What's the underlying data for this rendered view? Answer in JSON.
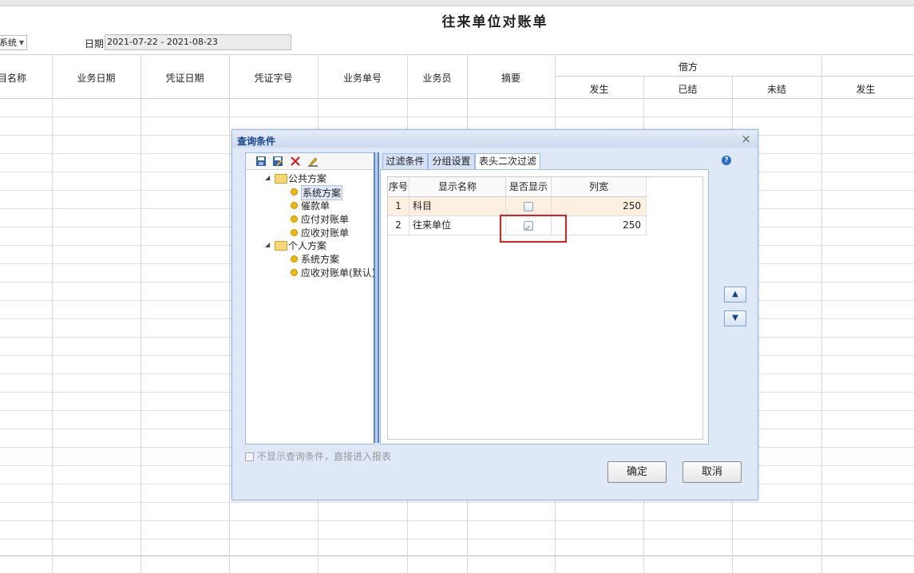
{
  "report": {
    "title": "往来单位对账单",
    "combo_value": "系统",
    "date_label": "日期",
    "date_value": "2021-07-22 - 2021-08-23"
  },
  "grid": {
    "headers": [
      "目名称",
      "业务日期",
      "凭证日期",
      "凭证字号",
      "业务单号",
      "业务员",
      "摘要"
    ],
    "group_debit": "借方",
    "sub_headers": [
      "发生",
      "已结",
      "未结",
      "发生"
    ]
  },
  "dialog": {
    "title": "查询条件",
    "close": "×",
    "tree": {
      "public": "公共方案",
      "public_items": [
        "系统方案",
        "催款单",
        "应付对账单",
        "应收对账单"
      ],
      "personal": "个人方案",
      "personal_items": [
        "系统方案",
        "应收对账单(默认)"
      ]
    },
    "tabs": [
      "过滤条件",
      "分组设置",
      "表头二次过滤"
    ],
    "active_tab": 2,
    "table": {
      "headers": [
        "序号",
        "显示名称",
        "是否显示",
        "列宽"
      ],
      "rows": [
        {
          "no": "1",
          "name": "科目",
          "show": false,
          "width": "250"
        },
        {
          "no": "2",
          "name": "往来单位",
          "show": true,
          "width": "250"
        }
      ]
    },
    "help": "?",
    "up": "▲",
    "down": "▼",
    "skip_label": "不显示查询条件，直接进入报表",
    "ok": "确定",
    "cancel": "取消"
  }
}
